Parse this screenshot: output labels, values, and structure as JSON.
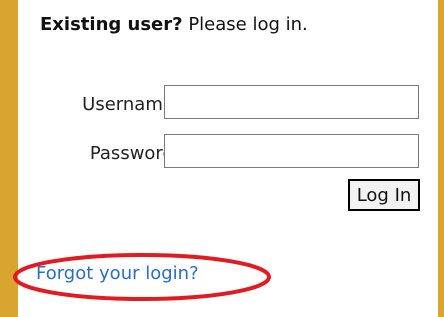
{
  "login": {
    "heading_bold": "Existing user?",
    "heading_rest": " Please log in.",
    "username_label": "Username:",
    "password_label": "Password:",
    "username_value": "",
    "password_value": "",
    "login_button": "Log In",
    "forgot_link": "Forgot your login?"
  },
  "theme": {
    "border_color": "#d9a52e",
    "link_color": "#2b6cc4",
    "highlight_color": "#e01b22"
  }
}
